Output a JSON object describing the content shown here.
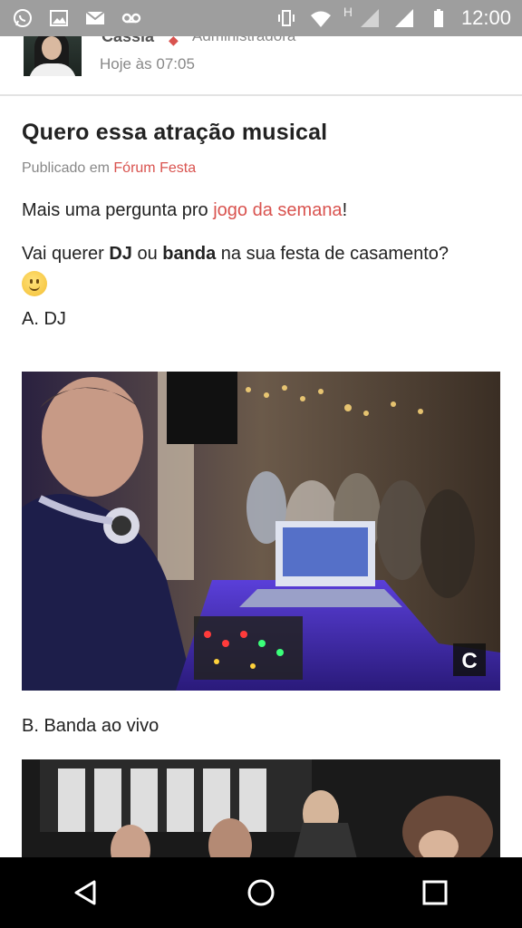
{
  "status_bar": {
    "time": "12:00",
    "network_letter": "H",
    "left_icons": [
      "whatsapp-icon",
      "image-icon",
      "mail-icon",
      "voicemail-icon"
    ],
    "right_icons": [
      "vibrate-icon",
      "wifi-icon",
      "signal-icon",
      "signal-icon",
      "battery-icon"
    ]
  },
  "author": {
    "name": "Cássia",
    "role": "Administradora",
    "time": "Hoje às 07:05"
  },
  "post": {
    "title": "Quero essa atração musical",
    "published_prefix": "Publicado em",
    "forum_name": "Fórum Festa",
    "line1_prefix": "Mais uma pergunta pro ",
    "line1_link": "jogo da semana",
    "line1_suffix": "!",
    "question_a": "Vai querer ",
    "question_b": "DJ",
    "question_c": " ou ",
    "question_d": "banda",
    "question_e": " na sua festa de casamento?",
    "option_a": "A. DJ",
    "option_b": "B. Banda ao vivo"
  },
  "photo_dj": {
    "watermark_letter": "C"
  },
  "colors": {
    "accent": "#d9534f",
    "status_bar": "#9e9e9e",
    "nav_bar": "#000000"
  },
  "nav": {
    "back": "back-icon",
    "home": "home-icon",
    "recents": "recents-icon"
  }
}
